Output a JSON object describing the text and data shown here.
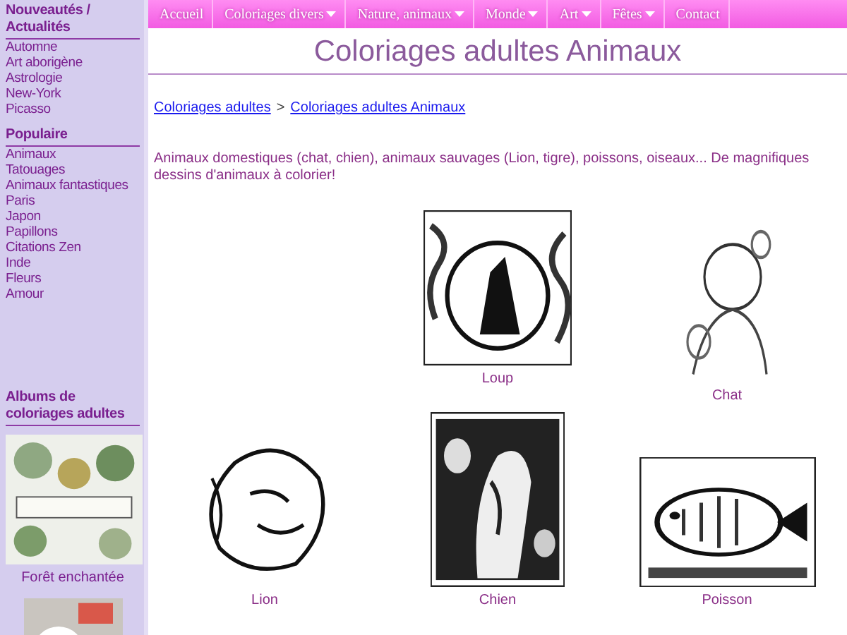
{
  "nav": [
    {
      "label": "Accueil",
      "dropdown": false
    },
    {
      "label": "Coloriages divers",
      "dropdown": true
    },
    {
      "label": "Nature, animaux",
      "dropdown": true
    },
    {
      "label": "Monde",
      "dropdown": true
    },
    {
      "label": "Art",
      "dropdown": true
    },
    {
      "label": "Fêtes",
      "dropdown": true
    },
    {
      "label": "Contact",
      "dropdown": false
    }
  ],
  "sidebar": {
    "sections": [
      {
        "heading": "Nouveautés / Actualités",
        "items": [
          "Automne",
          "Art aborigène",
          "Astrologie",
          "New-York",
          "Picasso"
        ]
      },
      {
        "heading": "Populaire",
        "items": [
          "Animaux",
          "Tatouages",
          "Animaux fantastiques",
          "Paris",
          "Japon",
          "Papillons",
          "Citations Zen",
          "Inde",
          "Fleurs",
          "Amour"
        ]
      }
    ],
    "albums": {
      "heading": "Albums de coloriages adultes",
      "items": [
        {
          "kind": "picture",
          "label": "Forêt enchantée"
        },
        {
          "kind": "picture"
        }
      ]
    }
  },
  "title": "Coloriages adultes Animaux",
  "breadcrumb": {
    "links": [
      "Coloriages adultes",
      "Coloriages adultes Animaux"
    ],
    "separator": ">"
  },
  "intro": "Animaux domestiques (chat, chien), animaux sauvages (Lion, tigre), poissons, oiseaux... De magnifiques dessins d'animaux à colorier!",
  "gallery": [
    {
      "kind": "picture",
      "label": "Loup"
    },
    {
      "kind": "picture",
      "label": "Chat"
    },
    {
      "kind": "picture",
      "label": "Lion"
    },
    {
      "kind": "picture",
      "label": "Chien"
    },
    {
      "kind": "picture",
      "label": "Poisson"
    }
  ]
}
